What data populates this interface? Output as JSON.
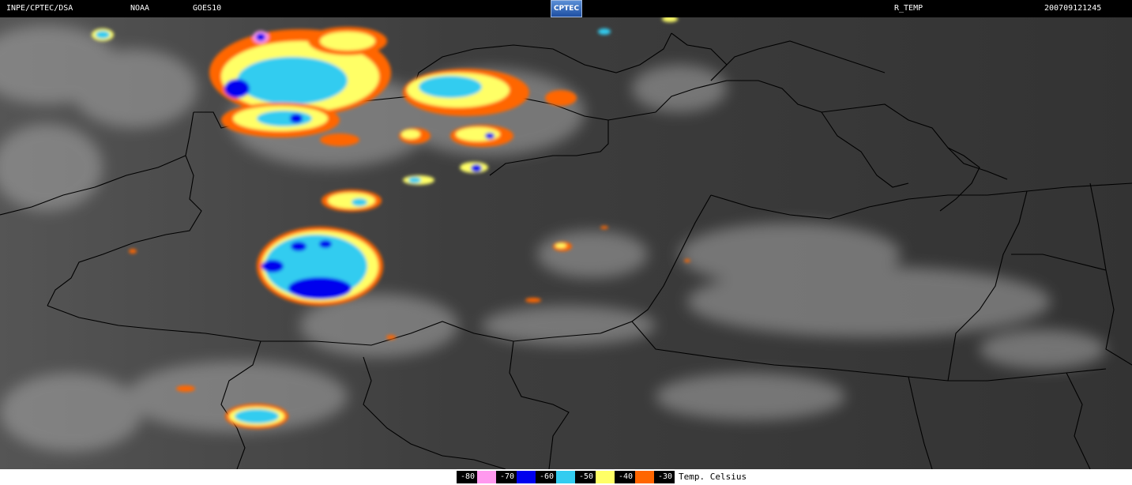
{
  "header": {
    "source": "INPE/CPTEC/DSA",
    "agency": "NOAA",
    "satellite": "GOES10",
    "logo_text": "CPTEC",
    "product": "R_TEMP",
    "timestamp": "200709121245"
  },
  "legend": {
    "title": "Temp. Celsius",
    "items": [
      {
        "label": "-80",
        "color": "#ff99ee"
      },
      {
        "label": "-70",
        "color": "#0000ee"
      },
      {
        "label": "-60",
        "color": "#33ccf0"
      },
      {
        "label": "-50",
        "color": "#ffff66"
      },
      {
        "label": "-40",
        "color": "#ff6600"
      },
      {
        "label": "-30",
        "color": "#000000"
      }
    ]
  },
  "colors": {
    "background": "#3a3a3a",
    "border_lines": "#000000",
    "temp_-30": "#ff6600",
    "temp_-40": "#ffff66",
    "temp_-50": "#33ccf0",
    "temp_-60": "#0000ee",
    "temp_-70": "#ff99ee"
  }
}
